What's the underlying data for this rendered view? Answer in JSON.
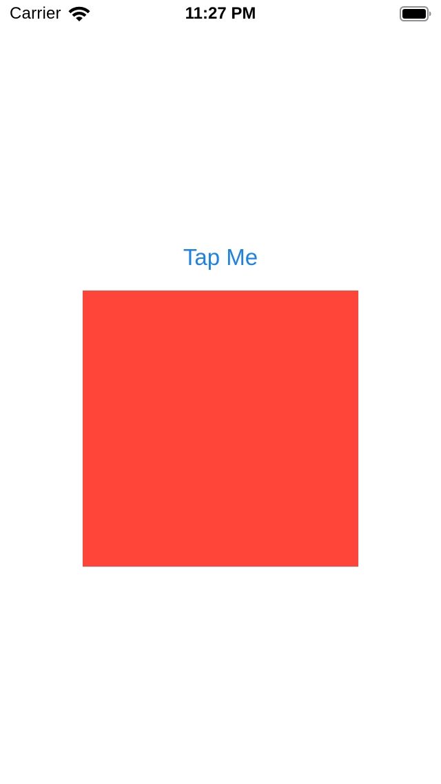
{
  "status_bar": {
    "carrier": "Carrier",
    "time": "11:27 PM",
    "wifi_icon": "wifi-icon",
    "battery_icon": "battery-icon",
    "battery_level": 1.0
  },
  "main": {
    "tap_button_label": "Tap Me",
    "tap_button_color": "#1a82e8",
    "square_color": "#ff453a"
  }
}
